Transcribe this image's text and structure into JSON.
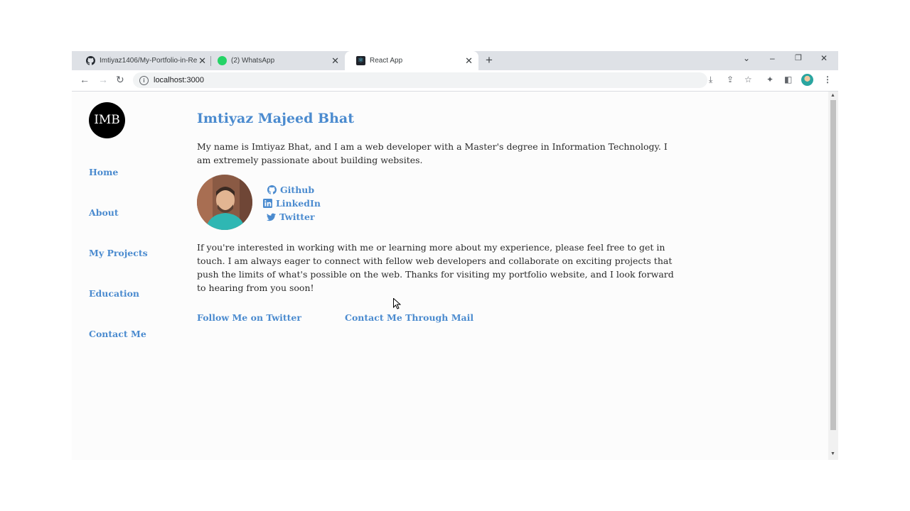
{
  "browser": {
    "tabs": [
      {
        "title": "Imtiyaz1406/My-Portfolio-in-Re",
        "favicon": "github-icon",
        "active": false
      },
      {
        "title": "(2) WhatsApp",
        "favicon": "whatsapp-icon",
        "active": false
      },
      {
        "title": "React App",
        "favicon": "react-icon",
        "active": true
      }
    ],
    "url": "localhost:3000"
  },
  "page": {
    "logo_text": "IMB",
    "nav": [
      "Home",
      "About",
      "My Projects",
      "Education",
      "Contact Me"
    ],
    "headline": "Imtiyaz Majeed Bhat",
    "intro": "My name is Imtiyaz Bhat, and I am a web developer with a Master's degree in Information Technology. I am extremely passionate about building websites.",
    "social": [
      {
        "label": "Github",
        "icon": "github-icon"
      },
      {
        "label": "LinkedIn",
        "icon": "linkedin-icon"
      },
      {
        "label": "Twitter",
        "icon": "twitter-icon"
      }
    ],
    "contact_paragraph": "If you're interested in working with me or learning more about my experience, please feel free to get in touch. I am always eager to connect with fellow web developers and collaborate on exciting projects that push the limits of what's possible on the web. Thanks for visiting my portfolio website, and I look forward to hearing from you soon!",
    "cta_twitter": "Follow Me on Twitter",
    "cta_mail": "Contact Me Through Mail"
  },
  "colors": {
    "link": "#4b8bcf",
    "text": "#2a2a2a",
    "page_bg": "#fcfcfc",
    "tabbar_bg": "#dee1e6"
  }
}
